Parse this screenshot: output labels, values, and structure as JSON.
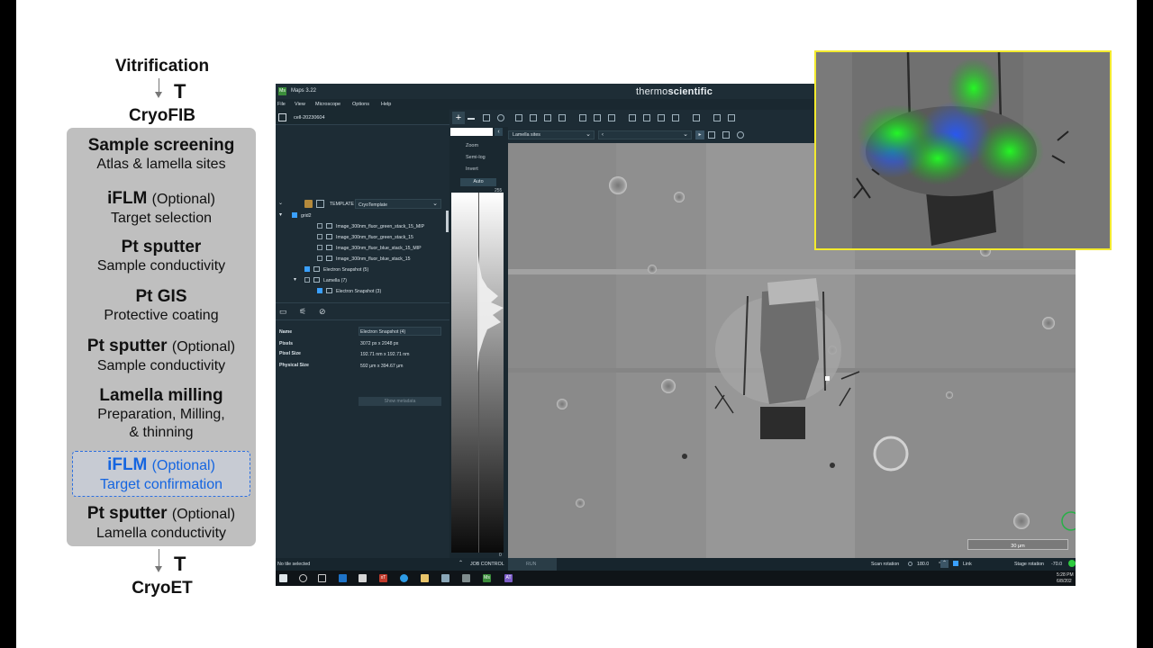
{
  "flow": {
    "top_step": "Vitrification",
    "tee_top": "T",
    "next_step": "CryoFIB",
    "tee_bottom": "T",
    "end_step": "CryoET",
    "steps": [
      {
        "title": "Sample screening",
        "optional": "",
        "desc": "Atlas & lamella sites"
      },
      {
        "title": "iFLM",
        "optional": "(Optional)",
        "desc": "Target selection"
      },
      {
        "title": "Pt sputter",
        "optional": "",
        "desc": "Sample conductivity"
      },
      {
        "title": "Pt GIS",
        "optional": "",
        "desc": "Protective coating"
      },
      {
        "title": "Pt sputter",
        "optional": "(Optional)",
        "desc": "Sample conductivity"
      },
      {
        "title": "Lamella milling",
        "optional": "",
        "desc": "Preparation, Milling,",
        "desc2": "& thinning"
      },
      {
        "title": "iFLM",
        "optional": "(Optional)",
        "desc": "Target confirmation"
      },
      {
        "title": "Pt sputter",
        "optional": "(Optional)",
        "desc": "Lamella conductivity"
      }
    ]
  },
  "app": {
    "title": "Maps 3.22",
    "icon_label": "Ms",
    "brand_left": "thermo",
    "brand_right": "scientific",
    "menu": [
      "File",
      "View",
      "Microscope",
      "Options",
      "Help"
    ],
    "cell_name": "cell-20230604",
    "template_label": "TEMPLATE",
    "template_value": "CryoTemplate",
    "tree": [
      {
        "label": "grid2",
        "indent": 0,
        "checked": true,
        "expander": "▾"
      },
      {
        "label": "Image_300nm_fluor_green_stack_15_MIP",
        "indent": 2,
        "checked": false,
        "expander": ""
      },
      {
        "label": "Image_300nm_fluor_green_stack_15",
        "indent": 2,
        "checked": false,
        "expander": ""
      },
      {
        "label": "Image_300nm_fluor_blue_stack_15_MIP",
        "indent": 2,
        "checked": false,
        "expander": ""
      },
      {
        "label": "Image_300nm_fluor_blue_stack_15",
        "indent": 2,
        "checked": false,
        "expander": ""
      },
      {
        "label": "Electron Snapshot (5)",
        "indent": 1,
        "checked": true,
        "expander": ""
      },
      {
        "label": "Lamella (7)",
        "indent": 1,
        "checked": false,
        "expander": "▾"
      },
      {
        "label": "Electron Snapshot (3)",
        "indent": 2,
        "checked": true,
        "expander": ""
      }
    ],
    "props": {
      "name_label": "Name",
      "name_value": "Electron Snapshot (4)",
      "pixels_label": "Pixels",
      "pixels_value": "3072 px  x  2048 px",
      "pixel_size_label": "Pixel Size",
      "pixel_size_value": "192.71 nm  x  192.71 nm",
      "physical_size_label": "Physical Size",
      "physical_size_value": "592 μm  x  394.67 μm",
      "metadata_button": "Show metadata"
    },
    "histogram": {
      "zoom": "Zoom",
      "semilog": "Semi-log",
      "invert": "Invert",
      "auto": "Auto",
      "max": "255",
      "min": "0"
    },
    "image_bar": {
      "layer_select": "Lamella sites"
    },
    "scale_label": "30 μm",
    "status": {
      "no_tile": "No tile selected",
      "job_control": "JOB CONTROL",
      "run": "RUN",
      "scan_rotation_label": "Scan rotation",
      "scan_rotation_value": "180.0",
      "link": "Link",
      "stage_rotation_label": "Stage rotation",
      "stage_rotation_value": "-70.0"
    },
    "clock": {
      "time": "5:28 PM",
      "date": "6/8/202"
    },
    "taskbar_labels": {
      "xt": "xT",
      "ms": "Ms",
      "at": "AT"
    }
  }
}
